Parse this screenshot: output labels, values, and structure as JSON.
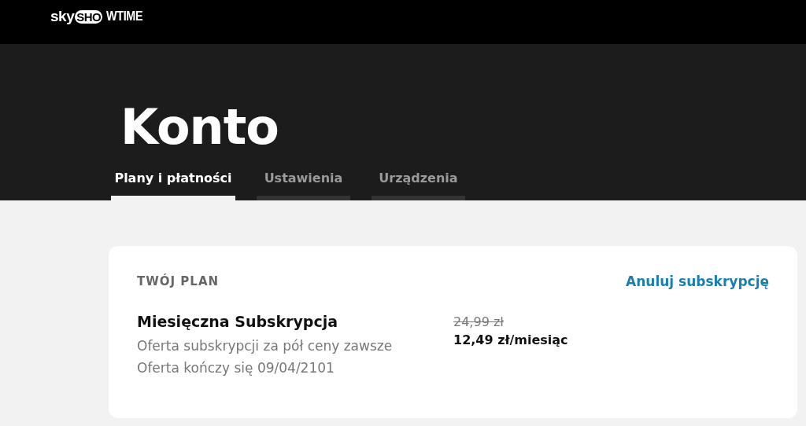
{
  "logo": {
    "parts": [
      "sky",
      "SHO",
      "WTIME"
    ]
  },
  "page_title": "Konto",
  "tabs": [
    {
      "label": "Plany i płatności",
      "selected": true
    },
    {
      "label": "Ustawienia",
      "selected": false
    },
    {
      "label": "Urządzenia",
      "selected": false
    }
  ],
  "plan_card": {
    "heading": "TWÓJ PLAN",
    "cancel_link": "Anuluj subskrypcję",
    "plan_name": "Miesięczna Subskrypcja",
    "details": [
      "Oferta subskrypcji za pół ceny zawsze",
      "Oferta kończy się 09/04/2101"
    ],
    "old_price": "24,99 zł",
    "price": "12,49 zł/miesiąc"
  }
}
